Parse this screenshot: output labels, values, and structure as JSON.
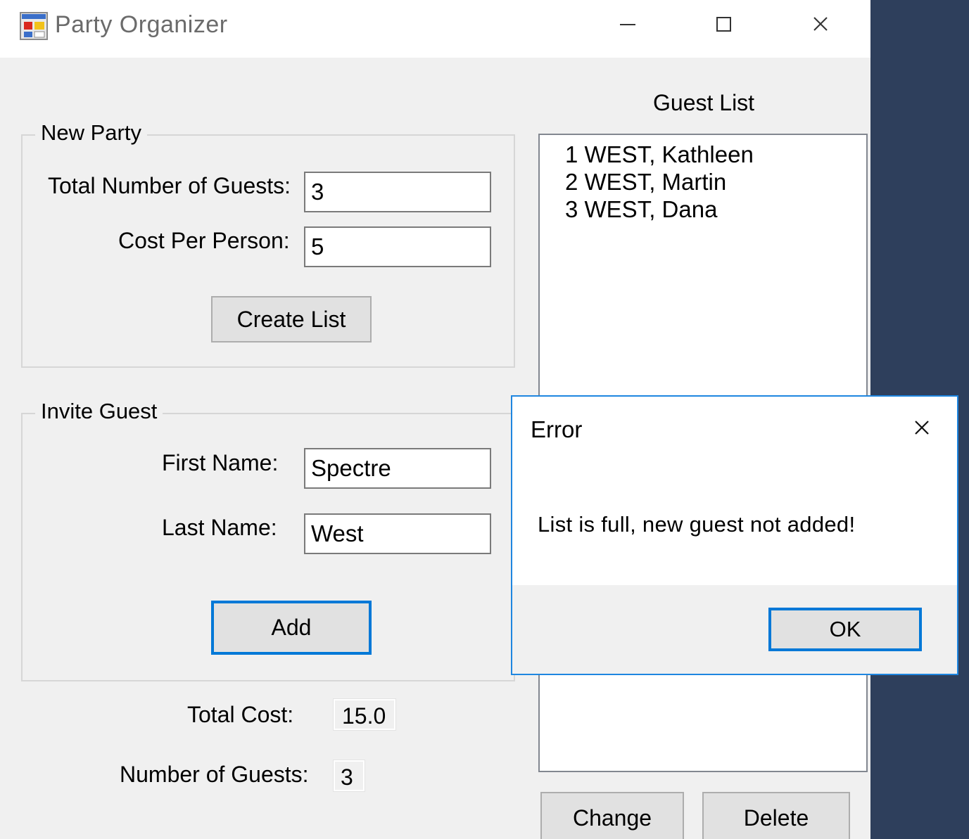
{
  "window": {
    "title": "Party Organizer",
    "controls": {
      "minimize_icon": "minimize-icon",
      "maximize_icon": "maximize-icon",
      "close_icon": "close-icon"
    }
  },
  "new_party": {
    "legend": "New Party",
    "total_guests_label": "Total Number of Guests:",
    "total_guests_value": "3",
    "cost_per_person_label": "Cost Per Person:",
    "cost_per_person_value": "5",
    "create_list_button": "Create List"
  },
  "invite_guest": {
    "legend": "Invite Guest",
    "first_name_label": "First Name:",
    "first_name_value": "Spectre",
    "last_name_label": "Last Name:",
    "last_name_value": "West",
    "add_button": "Add"
  },
  "summary": {
    "total_cost_label": "Total Cost:",
    "total_cost_value": "15.0",
    "num_guests_label": "Number of Guests:",
    "num_guests_value": "3"
  },
  "guest_list": {
    "title": "Guest List",
    "items": [
      "1 WEST, Kathleen",
      "2 WEST, Martin",
      "3 WEST, Dana"
    ],
    "change_button": "Change",
    "delete_button": "Delete"
  },
  "dialog": {
    "title": "Error",
    "message": "List is full, new guest not added!",
    "ok_button": "OK"
  },
  "colors": {
    "accent": "#0078d7",
    "window_bg": "#f0f0f0",
    "desktop_bg": "#2e3f5c"
  }
}
